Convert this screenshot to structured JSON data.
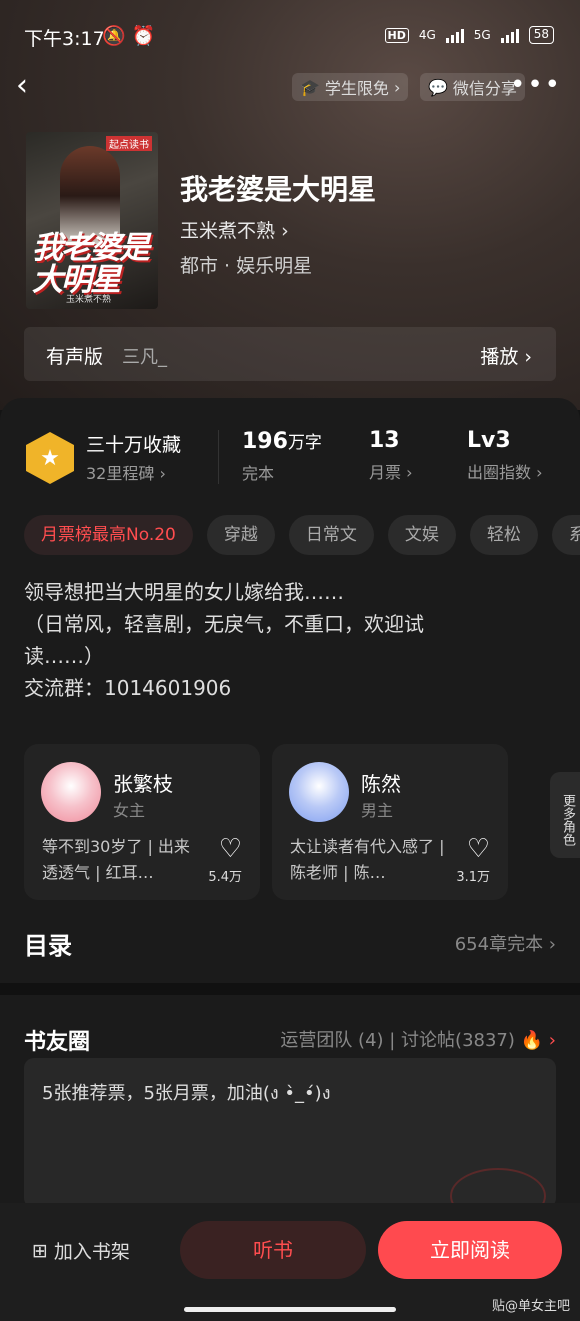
{
  "status": {
    "time": "下午3:17",
    "icons": "🔕 ⏰",
    "hd": "HD",
    "net4g": "4G",
    "net5g": "5G",
    "battery": "58"
  },
  "nav": {
    "back": "‹",
    "student": "学生限免",
    "share": "微信分享",
    "more": "•••"
  },
  "book": {
    "title": "我老婆是大明星",
    "author": "玉米煮不熟",
    "genre": "都市 · 娱乐明星",
    "cover_title": "我老婆是大明星",
    "cover_publisher": "起点读书",
    "cover_author": "玉米煮不熟"
  },
  "audio": {
    "label": "有声版",
    "narrator": "三凡_",
    "play": "播放 ›"
  },
  "stats": {
    "collect": "三十万收藏",
    "milestone": "32里程碑 ›",
    "words": "196",
    "words_unit": "万字",
    "words_status": "完本",
    "votes": "13",
    "votes_label": "月票 ›",
    "level": "Lv3",
    "level_label": "出圈指数 ›"
  },
  "tags": [
    "月票榜最高No.20",
    "穿越",
    "日常文",
    "文娱",
    "轻松",
    "系"
  ],
  "intro": {
    "line1": "领导想把当大明星的女儿嫁给我……",
    "line2": "（日常风，轻喜剧，无戾气，不重口，欢迎试读……）",
    "line3": "交流群：1014601906"
  },
  "roles": [
    {
      "name": "张繁枝",
      "type": "女主",
      "desc": "等不到30岁了 | 出来透透气 | 红耳…",
      "likes": "5.4万",
      "color": "#f08a9a"
    },
    {
      "name": "陈然",
      "type": "男主",
      "desc": "太让读者有代入感了 | 陈老师 | 陈…",
      "likes": "3.1万",
      "color": "#7f9ef0"
    }
  ],
  "more_roles": "更多角色",
  "toc": {
    "title": "目录",
    "info": "654章完本 ›"
  },
  "circle": {
    "title": "书友圈",
    "info": "运营团队 (4) | 讨论帖(3837)",
    "fire": "🔥 ›",
    "post": "5张推荐票，5张月票，加油(ง •̀_•́)ง"
  },
  "bottom": {
    "shelf": "加入书架",
    "listen": "听书",
    "read": "立即阅读",
    "watermark": "贴@单女主吧"
  },
  "colors": {
    "accent": "#ff4a4f",
    "gold": "#f0b429"
  }
}
